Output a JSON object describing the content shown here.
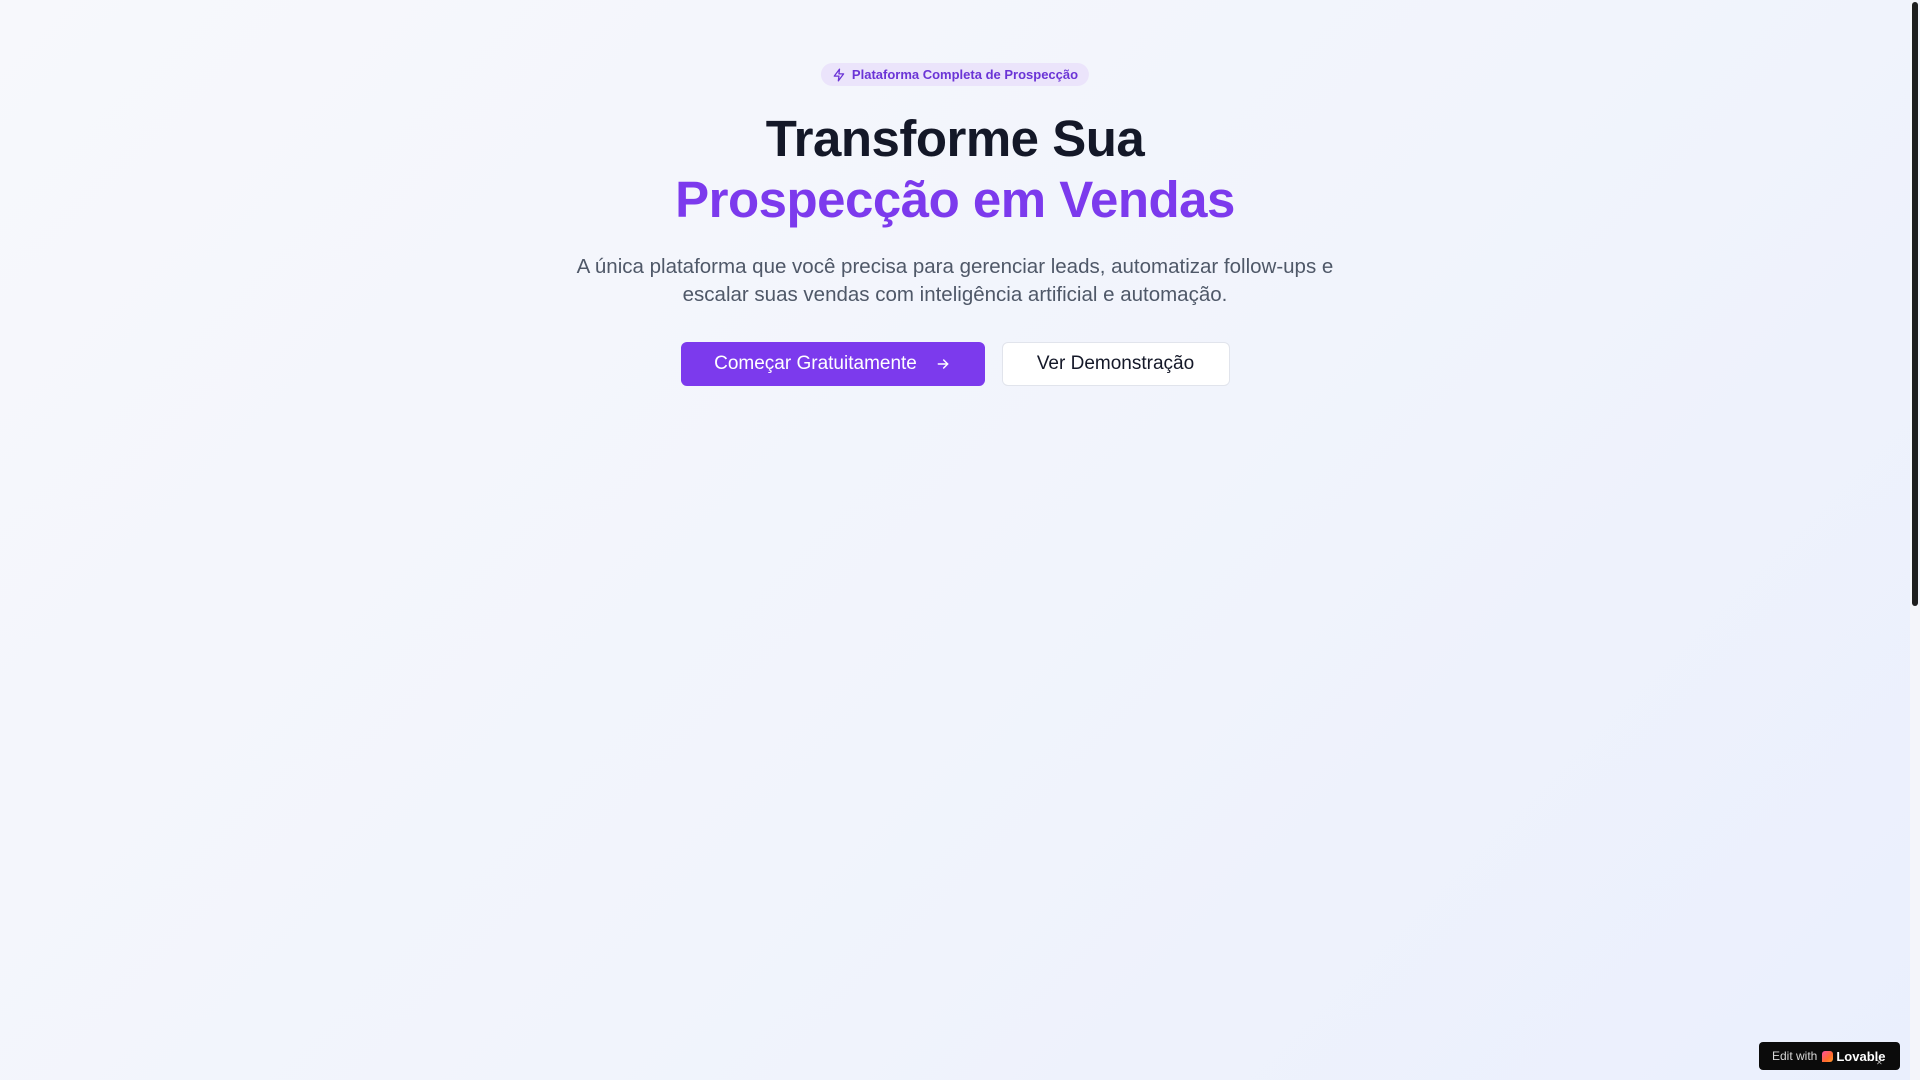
{
  "hero": {
    "badge_label": "Plataforma Completa de Prospecção",
    "badge_icon": "zap-icon",
    "title_line1": "Transforme Sua",
    "title_line2": "Prospecção em Vendas",
    "subtitle": "A única plataforma que você precisa para gerenciar leads, automatizar follow-ups e escalar suas vendas com inteligência artificial e automação.",
    "primary_button": {
      "label": "Começar Gratuitamente",
      "icon": "arrow-right-icon"
    },
    "secondary_button": {
      "label": "Ver Demonstração"
    }
  },
  "lovable_badge": {
    "prefix": "Edit with",
    "brand": "Lovable",
    "close_icon": "close-icon"
  },
  "colors": {
    "accent": "#7c3aed",
    "heading": "#141828",
    "body_text": "#4f5868",
    "badge_background": "#ebe4fb"
  }
}
